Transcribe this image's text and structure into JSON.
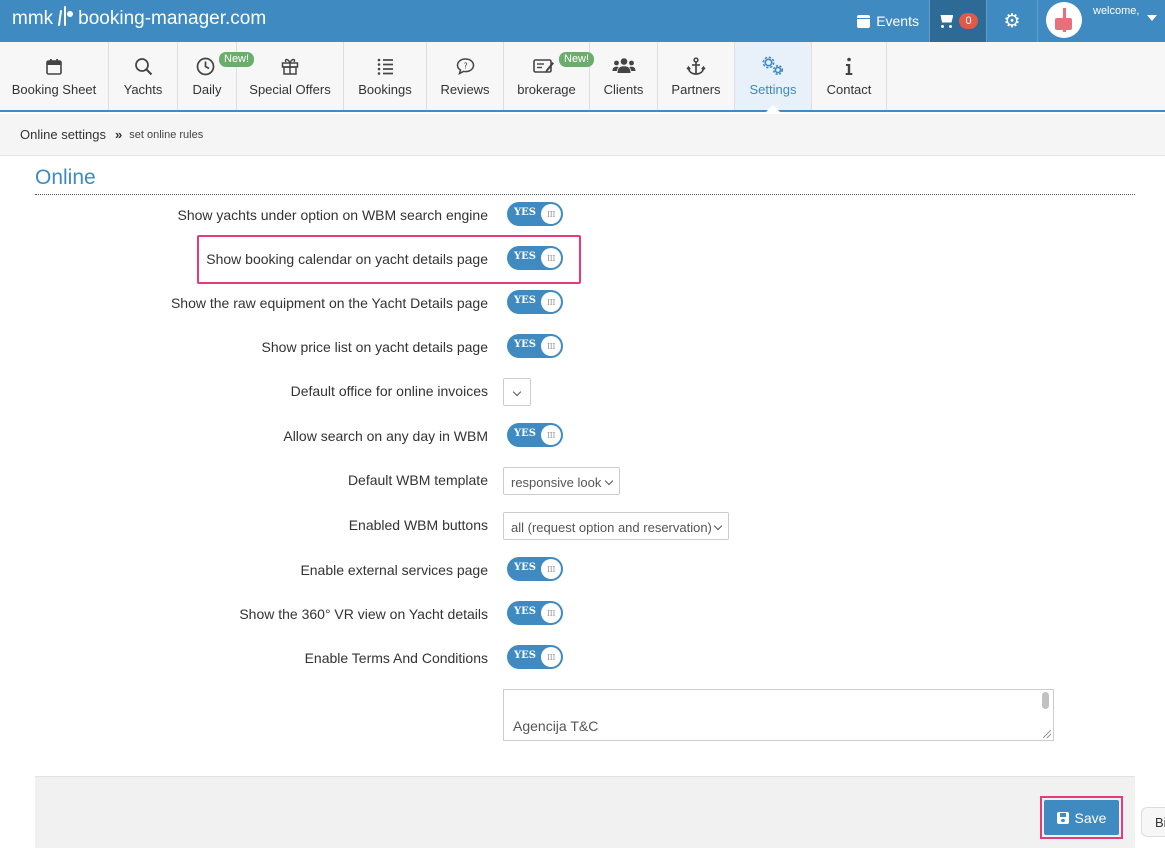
{
  "topbar": {
    "logo_prefix": "mmk",
    "logo_suffix": "booking-manager.com",
    "events_label": "Events",
    "cart_count": "0",
    "welcome": "welcome,"
  },
  "nav": [
    {
      "label": "Booking Sheet",
      "icon": "calendar-icon",
      "new": ""
    },
    {
      "label": "Yachts",
      "icon": "search-icon",
      "new": ""
    },
    {
      "label": "Daily",
      "icon": "clock-icon",
      "new": "New!"
    },
    {
      "label": "Special Offers",
      "icon": "gift-icon",
      "new": ""
    },
    {
      "label": "Bookings",
      "icon": "list-icon",
      "new": ""
    },
    {
      "label": "Reviews",
      "icon": "comment-icon",
      "new": ""
    },
    {
      "label": "brokerage",
      "icon": "edit-icon",
      "new": "New!"
    },
    {
      "label": "Clients",
      "icon": "users-icon",
      "new": ""
    },
    {
      "label": "Partners",
      "icon": "anchor-icon",
      "new": ""
    },
    {
      "label": "Settings",
      "icon": "gears-icon",
      "new": ""
    },
    {
      "label": "Contact",
      "icon": "info-icon",
      "new": ""
    }
  ],
  "breadcrumb": {
    "parent": "Online settings",
    "current": "set online rules"
  },
  "section": {
    "title": "Online"
  },
  "settings": [
    {
      "label": "Show yachts under option on WBM search engine",
      "type": "toggle",
      "value": "YES"
    },
    {
      "label": "Show booking calendar on yacht details page",
      "type": "toggle",
      "value": "YES"
    },
    {
      "label": "Show the raw equipment on the Yacht Details page",
      "type": "toggle",
      "value": "YES"
    },
    {
      "label": "Show price list on yacht details page",
      "type": "toggle",
      "value": "YES"
    },
    {
      "label": "Default office for online invoices",
      "type": "select",
      "value": ""
    },
    {
      "label": "Allow search on any day in WBM",
      "type": "toggle",
      "value": "YES"
    },
    {
      "label": "Default WBM template",
      "type": "select",
      "value": "responsive look"
    },
    {
      "label": "Enabled WBM buttons",
      "type": "select",
      "value": "all (request option and reservation)"
    },
    {
      "label": "Enable external services page",
      "type": "toggle",
      "value": "YES"
    },
    {
      "label": "Show the 360° VR view on Yacht details",
      "type": "toggle",
      "value": "YES"
    },
    {
      "label": "Enable Terms And Conditions",
      "type": "toggle",
      "value": "YES"
    }
  ],
  "toggle_knob": "III",
  "terms_text": "Agencija T&C",
  "save_label": "Save",
  "side_tab_label": "Bi",
  "colors": {
    "primary": "#3f8ac1",
    "highlight": "#e63b7a",
    "badge": "#e05a47",
    "new_tag": "#6bad6b"
  }
}
